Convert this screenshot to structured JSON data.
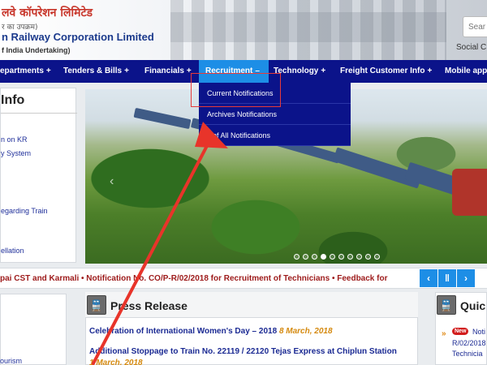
{
  "header": {
    "hindi_title": "लवे कॉपरेशन लिमिटेड",
    "hindi_sub": "र का उपक्रम)",
    "title": "n Railway Corporation Limited",
    "subtitle": "f India Undertaking)",
    "search_placeholder": "Sear",
    "social": "Social C"
  },
  "nav": {
    "items": [
      {
        "label": "epartments",
        "plus": "+"
      },
      {
        "label": "Tenders & Bills",
        "plus": "+"
      },
      {
        "label": "Financials",
        "plus": "+"
      },
      {
        "label": "Recruitment",
        "plus": "–"
      },
      {
        "label": "Technology",
        "plus": "+"
      },
      {
        "label": "Freight Customer Info",
        "plus": "+"
      },
      {
        "label": "Mobile app",
        "plus": ""
      }
    ]
  },
  "dropdown": {
    "items": [
      "Current Notifications",
      "Archives Notifications",
      "s of All Notifications"
    ]
  },
  "left_panel": {
    "title": "Info",
    "links": [
      "n on KR",
      "y System",
      "egarding Train",
      "ellation"
    ]
  },
  "banner": {
    "prev": "‹",
    "dot_count": 10,
    "active_dot": 3
  },
  "ticker": {
    "text": "pai CST and Karmali  •  Notification No. CO/P-R/02/2018 for Recruitment of Technicians  •  Feedback for",
    "buttons": [
      "‹",
      "‖",
      "›"
    ]
  },
  "left_bottom": {
    "link": "ourism"
  },
  "press": {
    "icon": "🚆",
    "title": "Press Release",
    "items": [
      {
        "text": "Celebration of International Women's Day – 2018",
        "date": "8 March, 2018"
      },
      {
        "text": "Additional Stoppage to Train No. 22119 / 22120 Tejas Express at Chiplun Station",
        "date": "1 March, 2018"
      }
    ]
  },
  "quick": {
    "icon": "🚆",
    "title": "Quic",
    "badge": "New",
    "arrow": "»",
    "lines": [
      "Noti",
      "R/02/2018",
      "Technicia"
    ]
  },
  "colors": {
    "nav_bg": "#0b138a",
    "active_tab": "#1d8ee6",
    "highlight_border": "#e53a3a",
    "ticker_text": "#9d1a1a",
    "press_link": "#1b2a93",
    "press_date": "#d58a10"
  }
}
